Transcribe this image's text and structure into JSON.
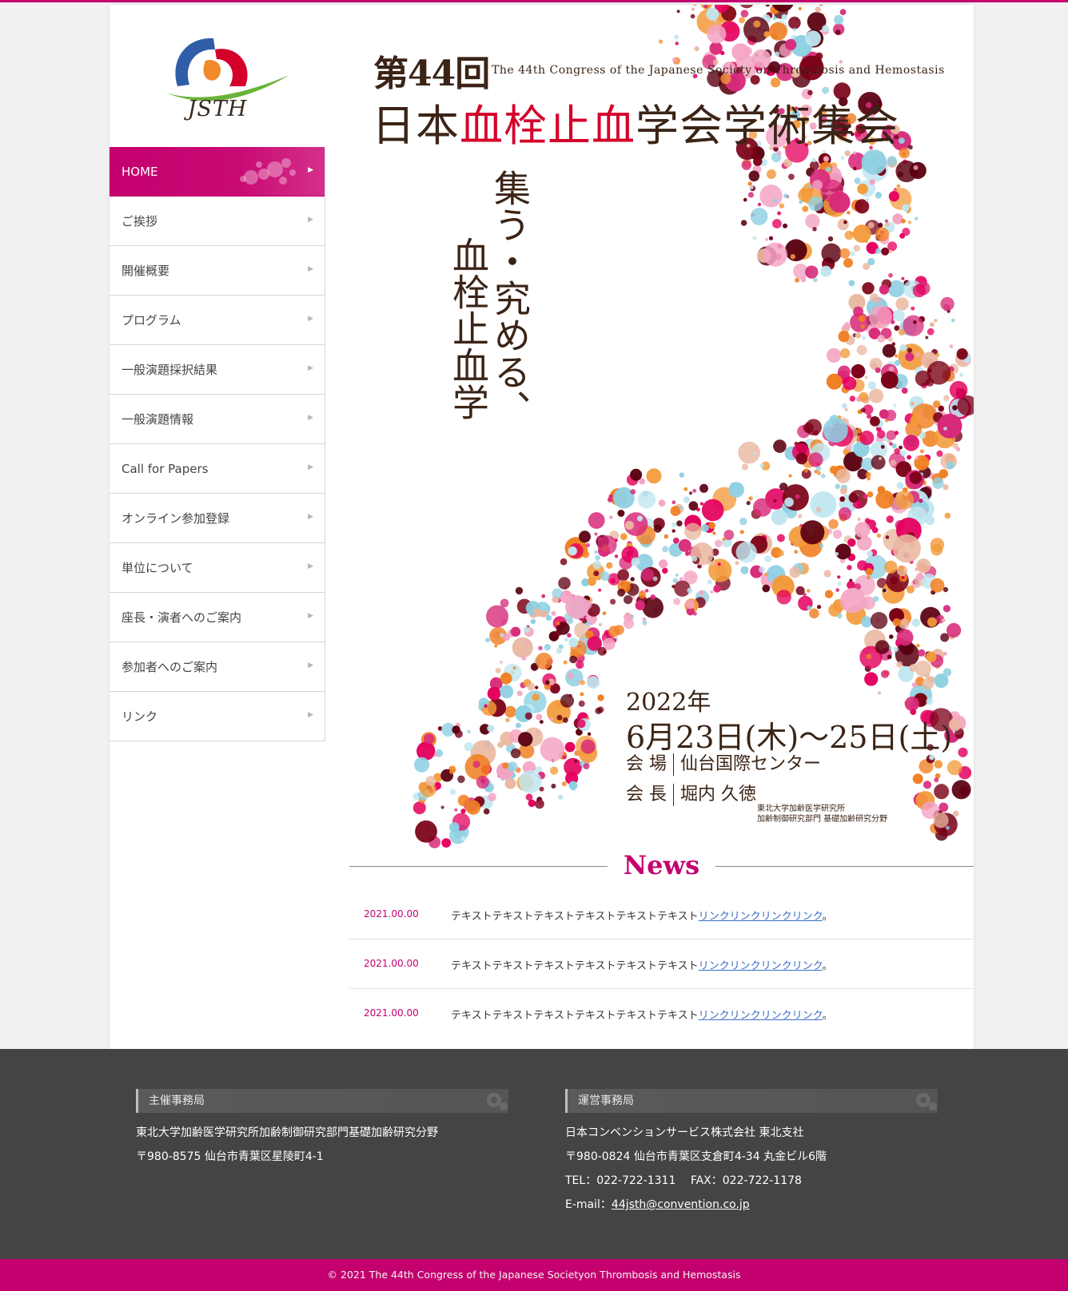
{
  "colors": {
    "accent": "#c4006e",
    "footer_bg": "#444444",
    "link": "#3a6bc8",
    "title_red": "#d4002a"
  },
  "logo": {
    "text": "JSTH"
  },
  "nav": {
    "items": [
      {
        "label": "HOME",
        "active": true
      },
      {
        "label": "ご挨拶"
      },
      {
        "label": "開催概要"
      },
      {
        "label": "プログラム"
      },
      {
        "label": "一般演題採択結果"
      },
      {
        "label": "一般演題情報"
      },
      {
        "label": "Call for Papers"
      },
      {
        "label": "オンライン参加登録"
      },
      {
        "label": "単位について"
      },
      {
        "label": "座長・演者へのご案内"
      },
      {
        "label": "参加者へのご案内"
      },
      {
        "label": "リンク"
      }
    ],
    "arrow": "▶"
  },
  "hero": {
    "edition": "第44回",
    "english_title": "The 44th Congress of the Japanese Society on Thrombosis and Hemostasis",
    "title_pre": "日本",
    "title_red": "血栓止血",
    "title_post": "学会学術集会",
    "catch_col1": "集う・究める、",
    "catch_col2": "血栓止血学",
    "year": "2022年",
    "dates": "6月23日(木)〜25日(土)",
    "venue_label": "会 場",
    "venue": "仙台国際センター",
    "president_label": "会 長",
    "president": "堀内 久徳",
    "affiliation_1": "東北大学加齢医学研究所",
    "affiliation_2": "加齢制御研究部門 基礎加齢研究分野"
  },
  "news": {
    "title": "News",
    "items": [
      {
        "date": "2021.00.00",
        "text": "テキストテキストテキストテキストテキストテキスト",
        "link": "リンクリンクリンクリンク",
        "end": "。"
      },
      {
        "date": "2021.00.00",
        "text": "テキストテキストテキストテキストテキストテキスト",
        "link": "リンクリンクリンクリンク",
        "end": "。"
      },
      {
        "date": "2021.00.00",
        "text": "テキストテキストテキストテキストテキストテキスト",
        "link": "リンクリンクリンクリンク",
        "end": "。"
      }
    ]
  },
  "footer": {
    "organizer": {
      "heading": "主催事務局",
      "line1": "東北大学加齢医学研究所加齢制御研究部門基礎加齢研究分野",
      "line2": "〒980-8575 仙台市青葉区星陵町4-1"
    },
    "operator": {
      "heading": "運営事務局",
      "line1": "日本コンベンションサービス株式会社 東北支社",
      "line2": "〒980-0824 仙台市青葉区支倉町4-34 丸金ビル6階",
      "line3": "TEL：022-722-1311　 FAX：022-722-1178",
      "email_label": "E-mail：",
      "email": "44jsth@convention.co.jp"
    },
    "copyright": "© 2021 The 44th Congress of the Japanese Societyon Thrombosis and Hemostasis"
  }
}
